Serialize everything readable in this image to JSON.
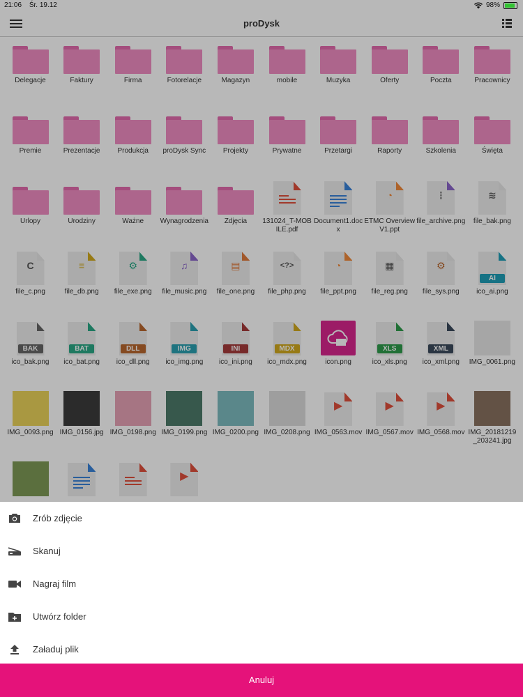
{
  "status_bar": {
    "time": "21:06",
    "date": "Śr. 19.12",
    "battery": "98%"
  },
  "header": {
    "title": "proDysk"
  },
  "folders": [
    "Delegacje",
    "Faktury",
    "Firma",
    "Fotorelacje",
    "Magazyn",
    "mobile",
    "Muzyka",
    "Oferty",
    "Poczta",
    "Pracownicy",
    "Premie",
    "Prezentacje",
    "Produkcja",
    "proDysk Sync",
    "Projekty",
    "Prywatne",
    "Przetargi",
    "Raporty",
    "Szkolenia",
    "Święta",
    "Urlopy",
    "Urodziny",
    "Ważne",
    "Wynagrodzenia",
    "Zdjęcia"
  ],
  "files": [
    {
      "name": "131024_T-MOBILE.pdf",
      "type": "pdf"
    },
    {
      "name": "Document1.docx",
      "type": "doc"
    },
    {
      "name": "ETMC Overview V1.ppt",
      "type": "ppt"
    },
    {
      "name": "file_archive.png",
      "type": "zip"
    },
    {
      "name": "file_bak.png",
      "type": "disk"
    },
    {
      "name": "file_c.png",
      "type": "c"
    },
    {
      "name": "file_db.png",
      "type": "db"
    },
    {
      "name": "file_exe.png",
      "type": "exe"
    },
    {
      "name": "file_music.png",
      "type": "music"
    },
    {
      "name": "file_one.png",
      "type": "one"
    },
    {
      "name": "file_php.png",
      "type": "php"
    },
    {
      "name": "file_ppt.png",
      "type": "ppt"
    },
    {
      "name": "file_reg.png",
      "type": "reg"
    },
    {
      "name": "file_sys.png",
      "type": "sys"
    },
    {
      "name": "ico_ai.png",
      "type": "badge",
      "badge": "AI",
      "color": "#1f9fb8"
    },
    {
      "name": "ico_bak.png",
      "type": "badge",
      "badge": "BAK",
      "color": "#666666"
    },
    {
      "name": "ico_bat.png",
      "type": "badge",
      "badge": "BAT",
      "color": "#2aa886"
    },
    {
      "name": "ico_dll.png",
      "type": "badge",
      "badge": "DLL",
      "color": "#b9672f"
    },
    {
      "name": "ico_img.png",
      "type": "badge",
      "badge": "IMG",
      "color": "#2aa0b0"
    },
    {
      "name": "ico_ini.png",
      "type": "badge",
      "badge": "INI",
      "color": "#a63b3b"
    },
    {
      "name": "ico_mdx.png",
      "type": "badge",
      "badge": "MDX",
      "color": "#d2a91e"
    },
    {
      "name": "icon.png",
      "type": "iconpng"
    },
    {
      "name": "ico_xls.png",
      "type": "badge",
      "badge": "XLS",
      "color": "#2e9b4b"
    },
    {
      "name": "ico_xml.png",
      "type": "badge",
      "badge": "XML",
      "color": "#3b4a5c"
    },
    {
      "name": "IMG_0061.png",
      "type": "photo",
      "color": "#e6e6e6"
    },
    {
      "name": "IMG_0093.png",
      "type": "photo",
      "color": "#ead35a"
    },
    {
      "name": "IMG_0156.jpg",
      "type": "photo",
      "color": "#3c3c3c"
    },
    {
      "name": "IMG_0198.png",
      "type": "photo",
      "color": "#e7a2b6"
    },
    {
      "name": "IMG_0199.png",
      "type": "photo",
      "color": "#4d7a6a"
    },
    {
      "name": "IMG_0200.png",
      "type": "photo",
      "color": "#7dbcc0"
    },
    {
      "name": "IMG_0208.png",
      "type": "photo",
      "color": "#dcdcdc"
    },
    {
      "name": "IMG_0563.mov",
      "type": "video"
    },
    {
      "name": "IMG_0567.mov",
      "type": "video"
    },
    {
      "name": "IMG_0568.mov",
      "type": "video"
    },
    {
      "name": "IMG_20181219_203241.jpg",
      "type": "photo",
      "color": "#8a7260"
    },
    {
      "name": "",
      "type": "photo",
      "color": "#7f9a57"
    },
    {
      "name": "",
      "type": "doc"
    },
    {
      "name": "",
      "type": "pdf"
    },
    {
      "name": "",
      "type": "video"
    }
  ],
  "sheet": {
    "items": [
      {
        "label": "Zrób zdjęcie",
        "icon": "camera-icon"
      },
      {
        "label": "Skanuj",
        "icon": "scanner-icon"
      },
      {
        "label": "Nagraj film",
        "icon": "video-camera-icon"
      },
      {
        "label": "Utwórz folder",
        "icon": "create-folder-icon"
      },
      {
        "label": "Załaduj plik",
        "icon": "upload-icon"
      }
    ],
    "cancel_label": "Anuluj"
  }
}
